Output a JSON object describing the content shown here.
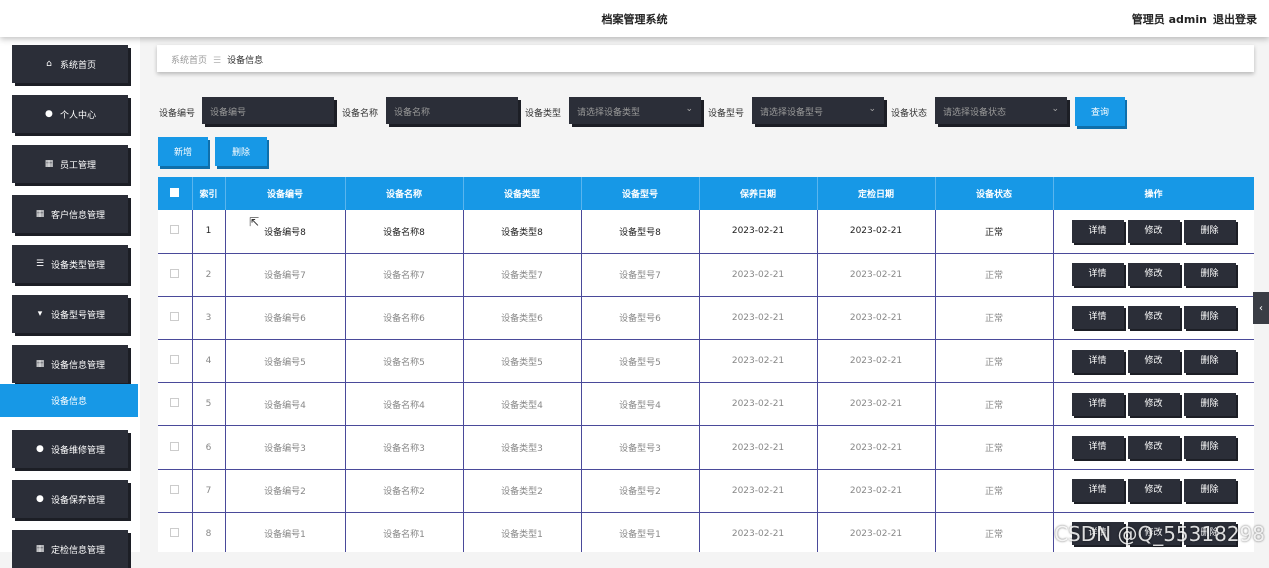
{
  "header": {
    "title": "档案管理系统",
    "role_user": "管理员 admin",
    "logout": "退出登录"
  },
  "sidebar": {
    "items": [
      {
        "label": "系统首页",
        "icon": "home-icon",
        "glyph": "⌂"
      },
      {
        "label": "个人中心",
        "icon": "user-icon",
        "glyph": "●"
      },
      {
        "label": "员工管理",
        "icon": "grid-icon",
        "glyph": "▦"
      },
      {
        "label": "客户信息管理",
        "icon": "grid-icon",
        "glyph": "▦"
      },
      {
        "label": "设备类型管理",
        "icon": "sliders-icon",
        "glyph": "☰"
      },
      {
        "label": "设备型号管理",
        "icon": "pin-icon",
        "glyph": "▾"
      },
      {
        "label": "设备信息管理",
        "icon": "grid-icon",
        "glyph": "▦"
      },
      {
        "label": "设备维修管理",
        "icon": "user-icon",
        "glyph": "●"
      },
      {
        "label": "设备保养管理",
        "icon": "location-icon",
        "glyph": "●"
      },
      {
        "label": "定检信息管理",
        "icon": "grid-icon",
        "glyph": "▦"
      }
    ],
    "active_sub": "设备信息"
  },
  "breadcrumb": {
    "home": "系统首页",
    "sep": "☰",
    "current": "设备信息"
  },
  "search": {
    "code_label": "设备编号",
    "code_placeholder": "设备编号",
    "name_label": "设备名称",
    "name_placeholder": "设备名称",
    "type_label": "设备类型",
    "type_placeholder": "请选择设备类型",
    "model_label": "设备型号",
    "model_placeholder": "请选择设备型号",
    "status_label": "设备状态",
    "status_placeholder": "请选择设备状态",
    "query_button": "查询"
  },
  "actions": {
    "add": "新增",
    "delete": "删除"
  },
  "table": {
    "headers": [
      "索引",
      "设备编号",
      "设备名称",
      "设备类型",
      "设备型号",
      "保养日期",
      "定检日期",
      "设备状态",
      "操作"
    ],
    "op_labels": {
      "detail": "详情",
      "edit": "修改",
      "delete": "删除"
    },
    "rows": [
      {
        "idx": "1",
        "code": "设备编号8",
        "name": "设备名称8",
        "type": "设备类型8",
        "model": "设备型号8",
        "maint": "2023-02-21",
        "insp": "2023-02-21",
        "status": "正常"
      },
      {
        "idx": "2",
        "code": "设备编号7",
        "name": "设备名称7",
        "type": "设备类型7",
        "model": "设备型号7",
        "maint": "2023-02-21",
        "insp": "2023-02-21",
        "status": "正常"
      },
      {
        "idx": "3",
        "code": "设备编号6",
        "name": "设备名称6",
        "type": "设备类型6",
        "model": "设备型号6",
        "maint": "2023-02-21",
        "insp": "2023-02-21",
        "status": "正常"
      },
      {
        "idx": "4",
        "code": "设备编号5",
        "name": "设备名称5",
        "type": "设备类型5",
        "model": "设备型号5",
        "maint": "2023-02-21",
        "insp": "2023-02-21",
        "status": "正常"
      },
      {
        "idx": "5",
        "code": "设备编号4",
        "name": "设备名称4",
        "type": "设备类型4",
        "model": "设备型号4",
        "maint": "2023-02-21",
        "insp": "2023-02-21",
        "status": "正常"
      },
      {
        "idx": "6",
        "code": "设备编号3",
        "name": "设备名称3",
        "type": "设备类型3",
        "model": "设备型号3",
        "maint": "2023-02-21",
        "insp": "2023-02-21",
        "status": "正常"
      },
      {
        "idx": "7",
        "code": "设备编号2",
        "name": "设备名称2",
        "type": "设备类型2",
        "model": "设备型号2",
        "maint": "2023-02-21",
        "insp": "2023-02-21",
        "status": "正常"
      },
      {
        "idx": "8",
        "code": "设备编号1",
        "name": "设备名称1",
        "type": "设备类型1",
        "model": "设备型号1",
        "maint": "2023-02-21",
        "insp": "2023-02-21",
        "status": "正常"
      }
    ]
  },
  "collapse_glyph": "‹",
  "watermark": "CSDN @Q_55318298",
  "colors": {
    "accent": "#1798e6",
    "dark": "#2b2e38"
  }
}
